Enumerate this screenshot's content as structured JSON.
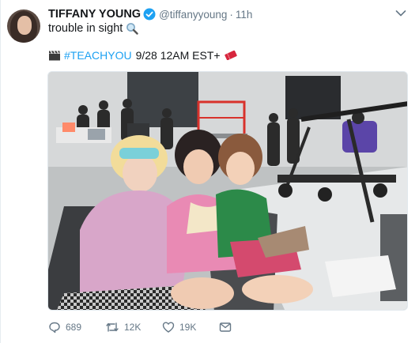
{
  "tweet": {
    "author_name": "TIFFANY YOUNG",
    "handle": "@tiffanyyoung",
    "separator": "·",
    "timestamp": "11h",
    "text_line1": "trouble in sight",
    "hashtag": "#TEACHYOU",
    "schedule": "9/28 12AM EST+",
    "icons": [
      "verified-badge-icon",
      "magnifying-glass-icon",
      "clapper-board-icon",
      "ticket-icon",
      "chevron-down-icon"
    ],
    "colors": {
      "link": "#1da1f2",
      "muted": "#657786",
      "text": "#14171a",
      "verified": "#1da1f2"
    }
  },
  "actions": {
    "reply_count": "689",
    "retweet_count": "12K",
    "like_count": "19K",
    "icons": [
      "reply-icon",
      "retweet-icon",
      "like-icon",
      "direct-message-icon"
    ]
  }
}
